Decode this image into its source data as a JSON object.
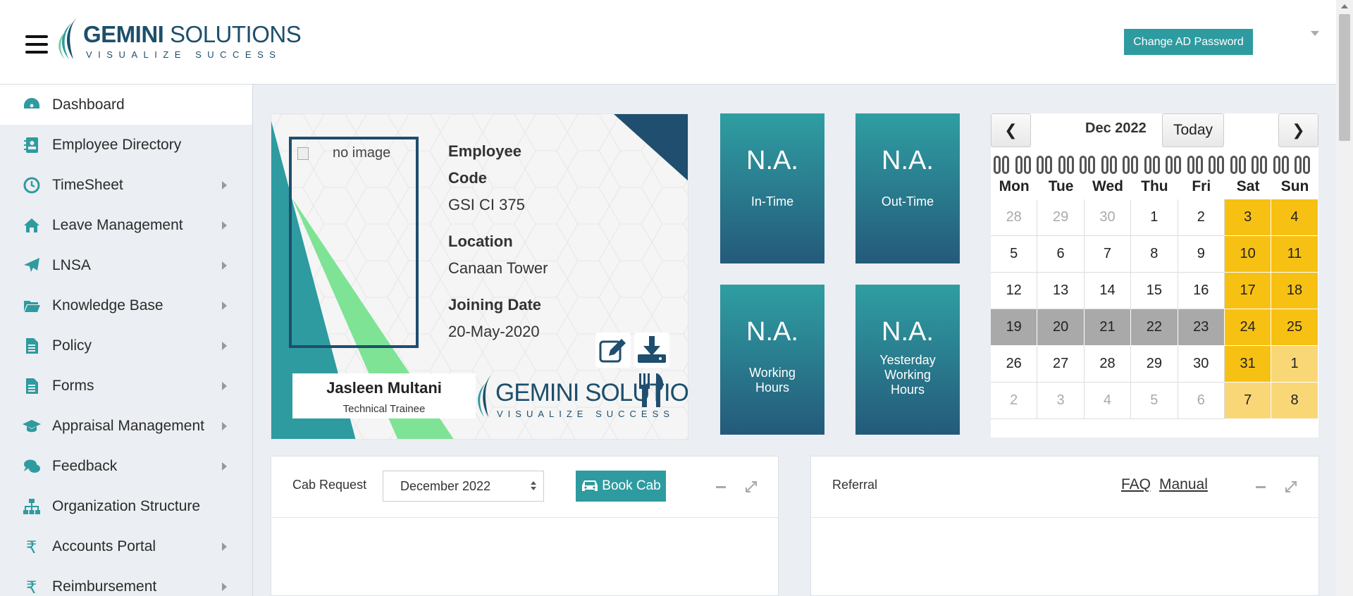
{
  "header": {
    "logo_name_bold": "GEMINI",
    "logo_name_rest": " SOLUTIONS",
    "logo_tagline": "VISUALIZE SUCCESS",
    "change_password_label": "Change AD Password"
  },
  "sidebar": {
    "items": [
      {
        "label": "Dashboard",
        "icon": "dashboard-icon",
        "has_arrow": false
      },
      {
        "label": "Employee Directory",
        "icon": "directory-icon",
        "has_arrow": false
      },
      {
        "label": "TimeSheet",
        "icon": "clock-icon",
        "has_arrow": true
      },
      {
        "label": "Leave Management",
        "icon": "home-icon",
        "has_arrow": true
      },
      {
        "label": "LNSA",
        "icon": "paper-plane-icon",
        "has_arrow": true
      },
      {
        "label": "Knowledge Base",
        "icon": "folder-icon",
        "has_arrow": true
      },
      {
        "label": "Policy",
        "icon": "document-icon",
        "has_arrow": true
      },
      {
        "label": "Forms",
        "icon": "document-icon",
        "has_arrow": true
      },
      {
        "label": "Appraisal Management",
        "icon": "graduation-cap-icon",
        "has_arrow": true
      },
      {
        "label": "Feedback",
        "icon": "chat-icon",
        "has_arrow": true
      },
      {
        "label": "Organization Structure",
        "icon": "sitemap-icon",
        "has_arrow": false
      },
      {
        "label": "Accounts Portal",
        "icon": "rupee-icon",
        "has_arrow": true
      },
      {
        "label": "Reimbursement",
        "icon": "rupee-icon",
        "has_arrow": true
      }
    ]
  },
  "idcard": {
    "image_alt": "no image",
    "employee_code_label_1": "Employee",
    "employee_code_label_2": "Code",
    "employee_code": "GSI CI 375",
    "location_label": "Location",
    "location": "Canaan Tower",
    "joining_label": "Joining Date",
    "joining_date": "20-May-2020",
    "name": "Jasleen Multani",
    "role": "Technical Trainee",
    "logo_text": "GEMINI SOLUTIO",
    "logo_tag": "VISUALIZE SUCCESS"
  },
  "tiles": {
    "in_time": {
      "value": "N.A.",
      "label": "In-Time"
    },
    "out_time": {
      "value": "N.A.",
      "label": "Out-Time"
    },
    "working": {
      "value": "N.A.",
      "label_1": "Working",
      "label_2": "Hours"
    },
    "yesterday": {
      "value": "N.A.",
      "label_1": "Yesterday",
      "label_2": "Working",
      "label_3": "Hours"
    }
  },
  "calendar": {
    "prev": "❮",
    "next": "❯",
    "title": "Dec 2022",
    "today_label": "Today",
    "weekdays": [
      "Mon",
      "Tue",
      "Wed",
      "Thu",
      "Fri",
      "Sat",
      "Sun"
    ],
    "weeks": [
      [
        [
          "28",
          "muted"
        ],
        [
          "29",
          "muted"
        ],
        [
          "30",
          "muted"
        ],
        [
          "1",
          ""
        ],
        [
          "2",
          ""
        ],
        [
          "3",
          "weekend"
        ],
        [
          "4",
          "weekend"
        ]
      ],
      [
        [
          "5",
          ""
        ],
        [
          "6",
          ""
        ],
        [
          "7",
          ""
        ],
        [
          "8",
          ""
        ],
        [
          "9",
          ""
        ],
        [
          "10",
          "weekend"
        ],
        [
          "11",
          "weekend"
        ]
      ],
      [
        [
          "12",
          ""
        ],
        [
          "13",
          ""
        ],
        [
          "14",
          ""
        ],
        [
          "15",
          ""
        ],
        [
          "16",
          ""
        ],
        [
          "17",
          "weekend"
        ],
        [
          "18",
          "weekend"
        ]
      ],
      [
        [
          "19",
          "leave"
        ],
        [
          "20",
          "leave"
        ],
        [
          "21",
          "leave"
        ],
        [
          "22",
          "leave"
        ],
        [
          "23",
          "leave"
        ],
        [
          "24",
          "weekend"
        ],
        [
          "25",
          "weekend"
        ]
      ],
      [
        [
          "26",
          ""
        ],
        [
          "27",
          ""
        ],
        [
          "28",
          ""
        ],
        [
          "29",
          ""
        ],
        [
          "30",
          ""
        ],
        [
          "31",
          "weekend"
        ],
        [
          "1",
          "weekend-muted"
        ]
      ],
      [
        [
          "2",
          "muted"
        ],
        [
          "3",
          "muted"
        ],
        [
          "4",
          "muted"
        ],
        [
          "5",
          "muted"
        ],
        [
          "6",
          "muted"
        ],
        [
          "7",
          "weekend-muted"
        ],
        [
          "8",
          "weekend-muted"
        ]
      ]
    ]
  },
  "cab_panel": {
    "title": "Cab Request",
    "month_value": "December 2022",
    "book_label": "Book Cab"
  },
  "referral_panel": {
    "title": "Referral",
    "faq_label": "FAQ",
    "manual_label": "Manual"
  },
  "colors": {
    "accent": "#2e9ba0",
    "navy": "#1f4e6e",
    "weekend": "#f7c114",
    "leave": "#a9a9a9"
  }
}
